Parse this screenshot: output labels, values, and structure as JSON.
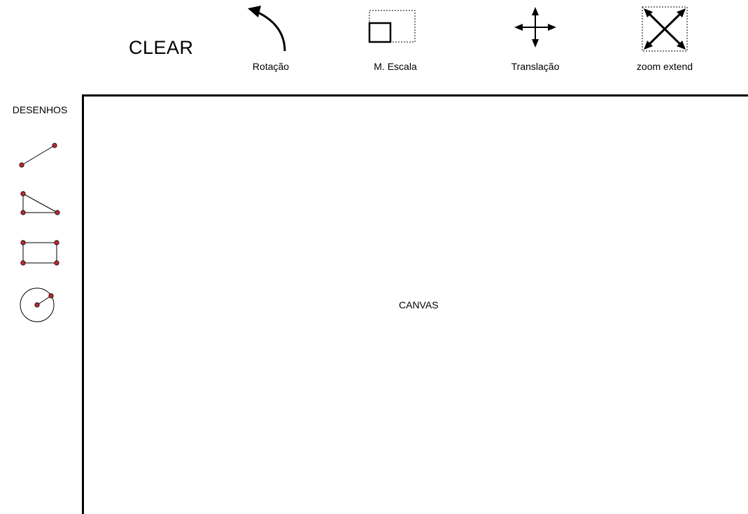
{
  "toolbar": {
    "clear_label": "CLEAR",
    "tools": [
      {
        "label": "Rotação",
        "icon": "rotate-icon"
      },
      {
        "label": "M. Escala",
        "icon": "scale-icon"
      },
      {
        "label": "Translação",
        "icon": "move-icon"
      },
      {
        "label": "zoom extend",
        "icon": "zoom-extend-icon"
      }
    ]
  },
  "sidebar": {
    "title": "DESENHOS",
    "items": [
      {
        "icon": "line-icon"
      },
      {
        "icon": "triangle-icon"
      },
      {
        "icon": "rectangle-icon"
      },
      {
        "icon": "circle-icon"
      }
    ]
  },
  "canvas": {
    "label": "CANVAS"
  },
  "colors": {
    "vertex": "#c0282d",
    "stroke": "#000000"
  }
}
